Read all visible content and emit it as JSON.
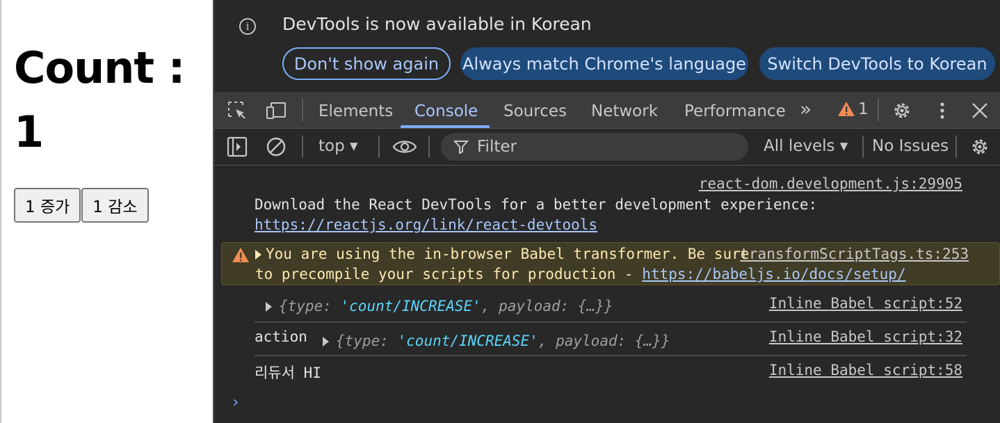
{
  "page": {
    "heading": "Count : 1",
    "buttons": {
      "increase": "1 증가",
      "decrease": "1 감소"
    }
  },
  "devtools": {
    "infobar": {
      "message": "DevTools is now available in Korean",
      "dont_show": "Don't show again",
      "always_match": "Always match Chrome's language",
      "switch": "Switch DevTools to Korean"
    },
    "tabs": [
      "Elements",
      "Console",
      "Sources",
      "Network",
      "Performance"
    ],
    "active_tab": "Console",
    "more_tabs": "»",
    "warnings_count": "1",
    "toolbar": {
      "context": "top ▾",
      "filter_placeholder": "Filter",
      "levels": "All levels ▾",
      "issues": "No Issues"
    },
    "console": {
      "messages": [
        {
          "source": "react-dom.development.js:29905",
          "line1": "Download the React DevTools for a better development experience:",
          "link": "https://reactjs.org/link/react-devtools"
        },
        {
          "level": "warning",
          "source": "transformScriptTags.ts:253",
          "line1": "You are using the in-browser Babel transformer. Be sure",
          "line2": "to precompile your scripts for production - ",
          "link": "https://babeljs.io/docs/setup/"
        },
        {
          "source": "Inline Babel script:52",
          "obj_open": "{type: ",
          "obj_str": "'count/INCREASE'",
          "obj_rest": ", payload: {…}}"
        },
        {
          "source": "Inline Babel script:32",
          "label": "action",
          "obj_open": "{type: ",
          "obj_str": "'count/INCREASE'",
          "obj_rest": ", payload: {…}}"
        },
        {
          "source": "Inline Babel script:58",
          "text": "리듀서 HI"
        }
      ],
      "prompt": "›"
    },
    "colors": {
      "background": "#282828",
      "toolbar": "#3c3c3c",
      "accent": "#a8c7fa",
      "warning_bg": "#413c26",
      "warning_icon": "#f28b54"
    }
  }
}
